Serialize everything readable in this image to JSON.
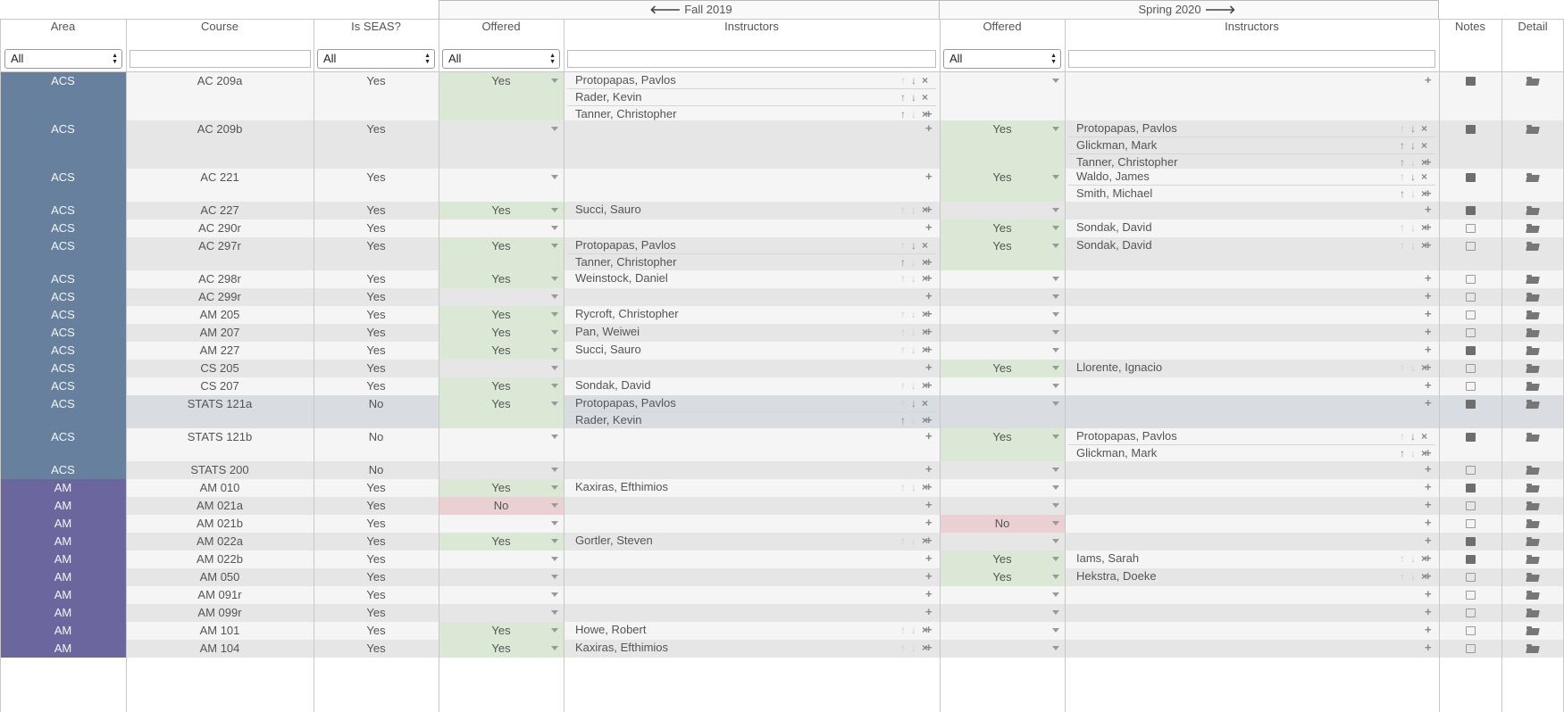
{
  "header": {
    "fall_label": "Fall 2019",
    "spring_label": "Spring 2020",
    "prev_icon": "arrow-left-icon",
    "next_icon": "arrow-right-icon",
    "columns": {
      "area": "Area",
      "course": "Course",
      "is_seas": "Is SEAS?",
      "fall_offered": "Offered",
      "fall_instructors": "Instructors",
      "spring_offered": "Offered",
      "spring_instructors": "Instructors",
      "notes": "Notes",
      "detail": "Detail"
    }
  },
  "filters": {
    "area": "All",
    "course": "",
    "is_seas": "All",
    "fall_offered": "All",
    "fall_instructors": "",
    "spring_offered": "All",
    "spring_instructors": ""
  },
  "colors": {
    "acs_area": "#66809e",
    "am_area": "#6b669e",
    "row_light": "#f5f5f5",
    "row_dark": "#e6e6e6",
    "row_highlight": "#d9dde1",
    "offered_yes": "#dbe8d6",
    "offered_no": "#ebd0d3"
  },
  "rows": [
    {
      "area": "ACS",
      "course": "AC 209a",
      "seas": "Yes",
      "fall": "Yes",
      "fall_inst": [
        "Protopapas, Pavlos",
        "Rader, Kevin",
        "Tanner, Christopher"
      ],
      "spring": "",
      "spring_inst": [],
      "note": "filled"
    },
    {
      "area": "ACS",
      "course": "AC 209b",
      "seas": "Yes",
      "fall": "",
      "fall_inst": [],
      "spring": "Yes",
      "spring_inst": [
        "Protopapas, Pavlos",
        "Glickman, Mark",
        "Tanner, Christopher"
      ],
      "note": "filled"
    },
    {
      "area": "ACS",
      "course": "AC 221",
      "seas": "Yes",
      "fall": "",
      "fall_inst": [],
      "spring": "Yes",
      "spring_inst": [
        "Waldo, James",
        "Smith, Michael"
      ],
      "note": "filled"
    },
    {
      "area": "ACS",
      "course": "AC 227",
      "seas": "Yes",
      "fall": "Yes",
      "fall_inst": [
        "Succi, Sauro"
      ],
      "spring": "",
      "spring_inst": [],
      "note": "filled"
    },
    {
      "area": "ACS",
      "course": "AC 290r",
      "seas": "Yes",
      "fall": "",
      "fall_inst": [],
      "spring": "Yes",
      "spring_inst": [
        "Sondak, David"
      ],
      "note": "empty"
    },
    {
      "area": "ACS",
      "course": "AC 297r",
      "seas": "Yes",
      "fall": "Yes",
      "fall_inst": [
        "Protopapas, Pavlos",
        "Tanner, Christopher"
      ],
      "spring": "Yes",
      "spring_inst": [
        "Sondak, David"
      ],
      "note": "empty"
    },
    {
      "area": "ACS",
      "course": "AC 298r",
      "seas": "Yes",
      "fall": "Yes",
      "fall_inst": [
        "Weinstock, Daniel"
      ],
      "spring": "",
      "spring_inst": [],
      "note": "empty"
    },
    {
      "area": "ACS",
      "course": "AC 299r",
      "seas": "Yes",
      "fall": "",
      "fall_inst": [],
      "spring": "",
      "spring_inst": [],
      "note": "empty"
    },
    {
      "area": "ACS",
      "course": "AM 205",
      "seas": "Yes",
      "fall": "Yes",
      "fall_inst": [
        "Rycroft, Christopher"
      ],
      "spring": "",
      "spring_inst": [],
      "note": "empty"
    },
    {
      "area": "ACS",
      "course": "AM 207",
      "seas": "Yes",
      "fall": "Yes",
      "fall_inst": [
        "Pan, Weiwei"
      ],
      "spring": "",
      "spring_inst": [],
      "note": "empty"
    },
    {
      "area": "ACS",
      "course": "AM 227",
      "seas": "Yes",
      "fall": "Yes",
      "fall_inst": [
        "Succi, Sauro"
      ],
      "spring": "",
      "spring_inst": [],
      "note": "filled"
    },
    {
      "area": "ACS",
      "course": "CS 205",
      "seas": "Yes",
      "fall": "",
      "fall_inst": [],
      "spring": "Yes",
      "spring_inst": [
        "Llorente, Ignacio"
      ],
      "note": "empty"
    },
    {
      "area": "ACS",
      "course": "CS 207",
      "seas": "Yes",
      "fall": "Yes",
      "fall_inst": [
        "Sondak, David"
      ],
      "spring": "",
      "spring_inst": [],
      "note": "empty"
    },
    {
      "area": "ACS",
      "course": "STATS 121a",
      "seas": "No",
      "fall": "Yes",
      "fall_inst": [
        "Protopapas, Pavlos",
        "Rader, Kevin"
      ],
      "spring": "",
      "spring_inst": [],
      "note": "filled",
      "highlight": true
    },
    {
      "area": "ACS",
      "course": "STATS 121b",
      "seas": "No",
      "fall": "",
      "fall_inst": [],
      "spring": "Yes",
      "spring_inst": [
        "Protopapas, Pavlos",
        "Glickman, Mark"
      ],
      "note": "filled"
    },
    {
      "area": "ACS",
      "course": "STATS 200",
      "seas": "No",
      "fall": "",
      "fall_inst": [],
      "spring": "",
      "spring_inst": [],
      "note": "empty"
    },
    {
      "area": "AM",
      "course": "AM 010",
      "seas": "Yes",
      "fall": "Yes",
      "fall_inst": [
        "Kaxiras, Efthimios"
      ],
      "spring": "",
      "spring_inst": [],
      "note": "filled"
    },
    {
      "area": "AM",
      "course": "AM 021a",
      "seas": "Yes",
      "fall": "No",
      "fall_inst": [],
      "spring": "",
      "spring_inst": [],
      "note": "empty"
    },
    {
      "area": "AM",
      "course": "AM 021b",
      "seas": "Yes",
      "fall": "",
      "fall_inst": [],
      "spring": "No",
      "spring_inst": [],
      "note": "empty"
    },
    {
      "area": "AM",
      "course": "AM 022a",
      "seas": "Yes",
      "fall": "Yes",
      "fall_inst": [
        "Gortler, Steven"
      ],
      "spring": "",
      "spring_inst": [],
      "note": "filled"
    },
    {
      "area": "AM",
      "course": "AM 022b",
      "seas": "Yes",
      "fall": "",
      "fall_inst": [],
      "spring": "Yes",
      "spring_inst": [
        "Iams, Sarah"
      ],
      "note": "filled"
    },
    {
      "area": "AM",
      "course": "AM 050",
      "seas": "Yes",
      "fall": "",
      "fall_inst": [],
      "spring": "Yes",
      "spring_inst": [
        "Hekstra, Doeke"
      ],
      "note": "empty"
    },
    {
      "area": "AM",
      "course": "AM 091r",
      "seas": "Yes",
      "fall": "",
      "fall_inst": [],
      "spring": "",
      "spring_inst": [],
      "note": "empty"
    },
    {
      "area": "AM",
      "course": "AM 099r",
      "seas": "Yes",
      "fall": "",
      "fall_inst": [],
      "spring": "",
      "spring_inst": [],
      "note": "empty"
    },
    {
      "area": "AM",
      "course": "AM 101",
      "seas": "Yes",
      "fall": "Yes",
      "fall_inst": [
        "Howe, Robert"
      ],
      "spring": "",
      "spring_inst": [],
      "note": "empty"
    },
    {
      "area": "AM",
      "course": "AM 104",
      "seas": "Yes",
      "fall": "Yes",
      "fall_inst": [
        "Kaxiras, Efthimios"
      ],
      "spring": "",
      "spring_inst": [],
      "note": "empty"
    }
  ]
}
